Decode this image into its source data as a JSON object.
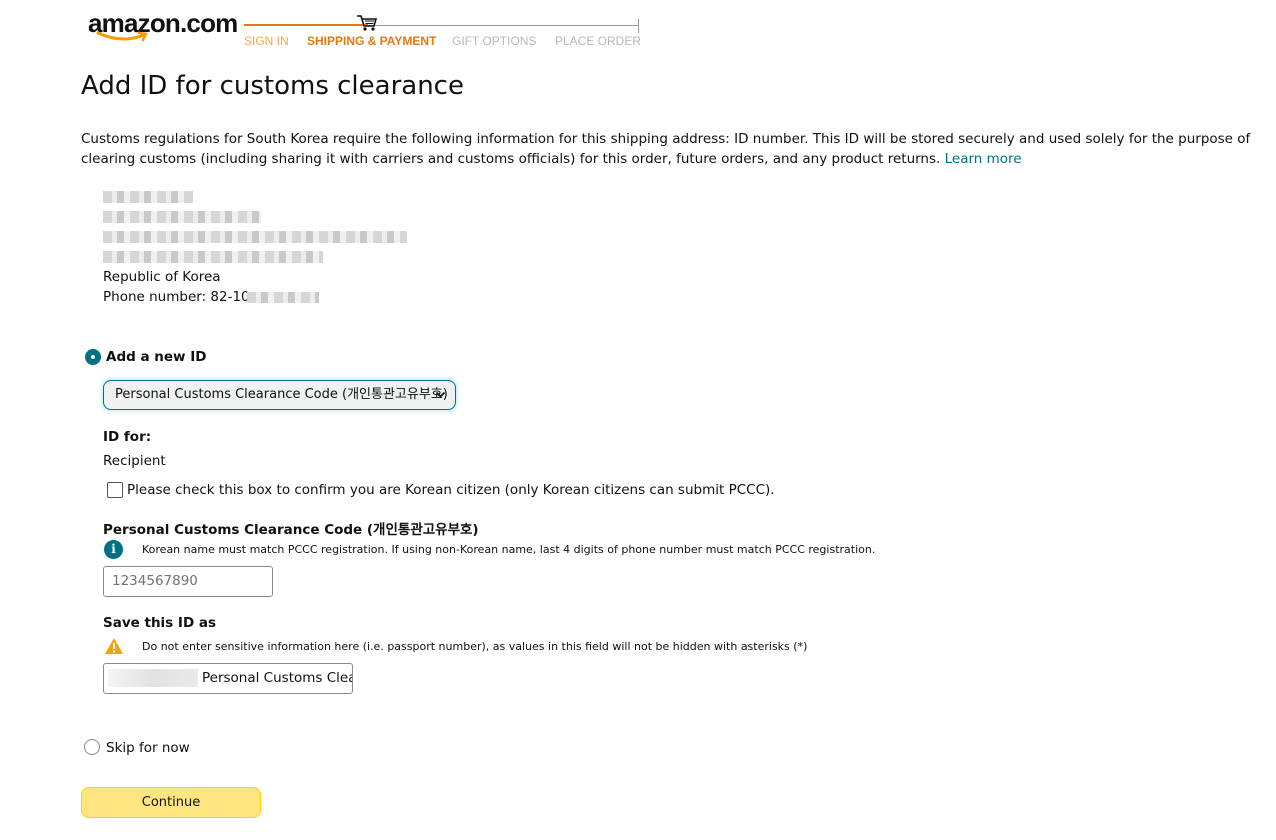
{
  "header": {
    "logo": "amazon.com",
    "steps": [
      "SIGN IN",
      "SHIPPING & PAYMENT",
      "GIFT OPTIONS",
      "PLACE ORDER"
    ]
  },
  "page_title": "Add ID for customs clearance",
  "description": "Customs regulations for South Korea require the following information for this shipping address: ID number. This ID will be stored securely and used solely for the purpose of clearing customs (including sharing it with carriers and customs officials) for this order, future orders, and any product returns.",
  "learn_more": "Learn more",
  "address": {
    "country": "Republic of Korea",
    "phone": "Phone number: 82-10-"
  },
  "add_new_id": {
    "label": "Add a new ID",
    "selected_type": "Personal Customs Clearance Code (개인통관고유부호)",
    "id_for_label": "ID for:",
    "id_for_value": "Recipient",
    "checkbox_label": "Please check this box to confirm you are Korean citizen (only Korean citizens can submit PCCC).",
    "pccc_label": "Personal Customs Clearance Code (개인통관고유부호)",
    "pccc_info": "Korean name must match PCCC registration. If using non-Korean name, last 4 digits of phone number must match PCCC registration.",
    "pccc_placeholder": "1234567890",
    "save_as_label": "Save this ID as",
    "save_as_warning": "Do not enter sensitive information here (i.e. passport number), as values in this field will not be hidden with asterisks (*)",
    "save_as_value": "Personal Customs Clear"
  },
  "skip_label": "Skip for now",
  "continue_label": "Continue",
  "colors": {
    "accent": "#007185",
    "progress": "#e47911",
    "button": "#ffe580"
  }
}
